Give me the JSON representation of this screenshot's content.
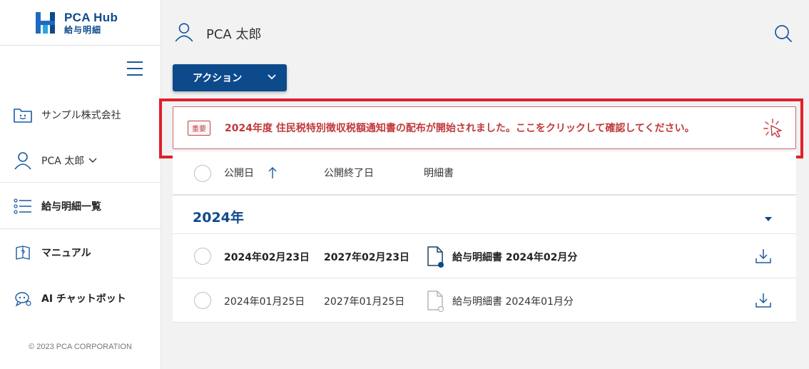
{
  "app": {
    "logo_title": "PCA Hub",
    "logo_subtitle": "給与明細",
    "brand_color": "#0d4a8c",
    "alert_color": "#c0393b"
  },
  "sidebar": {
    "menu_icon": "hamburger-icon",
    "company": {
      "label": "サンプル株式会社",
      "icon": "folder-smile-icon"
    },
    "user": {
      "label": "PCA 太郎",
      "icon": "user-icon"
    },
    "nav": [
      {
        "label": "給与明細一覧",
        "icon": "list-icon"
      },
      {
        "label": "マニュアル",
        "icon": "manual-icon"
      },
      {
        "label": "AI チャットボット",
        "icon": "chatbot-icon"
      }
    ],
    "copyright": "© 2023 PCA CORPORATION"
  },
  "header": {
    "user_name": "PCA 太郎",
    "search_icon": "search-icon"
  },
  "toolbar": {
    "action_label": "アクション"
  },
  "notice": {
    "badge": "重要",
    "text": "2024年度 住民税特別徴収税額通知書の配布が開始されました。ここをクリックして確認してください。"
  },
  "table": {
    "columns": {
      "published": "公開日",
      "end": "公開終了日",
      "document": "明細書"
    },
    "sort_icon": "arrow-up-icon",
    "year_group": "2024年",
    "rows": [
      {
        "published": "2024年02月23日",
        "end": "2027年02月23日",
        "document": "給与明細書 2024年02月分",
        "unread": true
      },
      {
        "published": "2024年01月25日",
        "end": "2027年01月25日",
        "document": "給与明細書 2024年01月分",
        "unread": false
      }
    ]
  }
}
